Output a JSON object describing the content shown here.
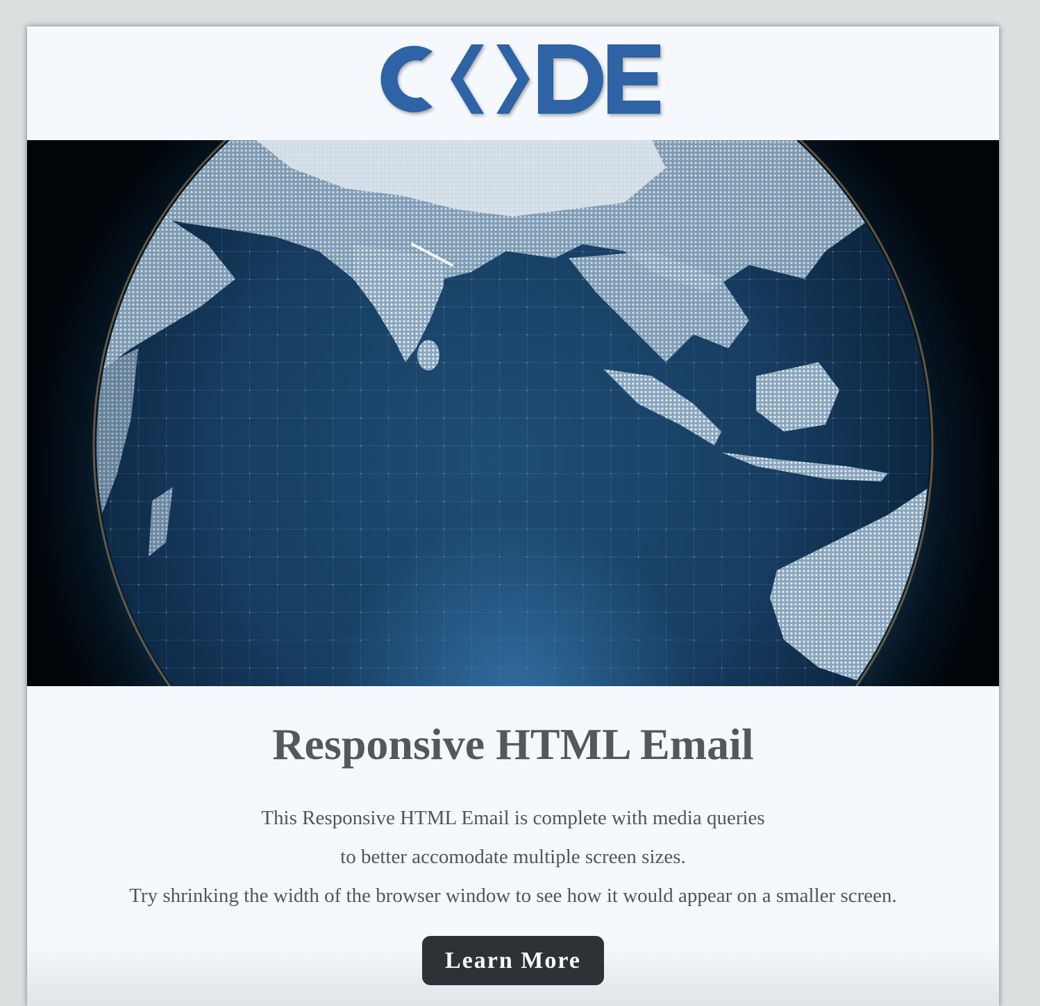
{
  "email": {
    "logo": {
      "text": "CODE",
      "icon": "code-brackets-logo",
      "color": "#2e64a5"
    },
    "hero": {
      "icon": "earth-globe-image"
    },
    "headline": "Responsive HTML Email",
    "body": {
      "line1": "This Responsive HTML Email is complete with media queries",
      "line2": "to better accomodate multiple screen sizes.",
      "line3": "Try shrinking the width of the browser window to see how it would appear on a smaller screen."
    },
    "cta": {
      "label": "Learn More",
      "background": "#2d3237",
      "text_color": "#ffffff"
    },
    "colors": {
      "page_background": "#dadfe0",
      "card_background": "#f5f8fd",
      "text": "#55575a"
    }
  }
}
